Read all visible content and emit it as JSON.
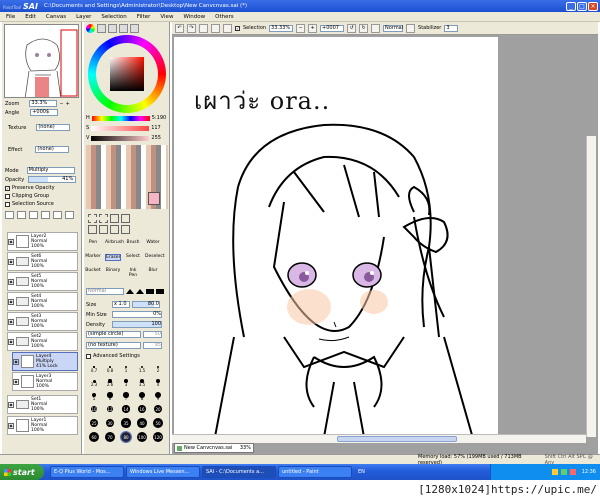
{
  "window": {
    "app_name": "SAI",
    "app_sub": "PaintTool",
    "title": "C:\\Documents and Settings\\Administrator\\Desktop\\New Canvcnvas.sai (*)"
  },
  "menu": [
    "File",
    "Edit",
    "Canvas",
    "Layer",
    "Selection",
    "Filter",
    "View",
    "Window",
    "Others"
  ],
  "navigator": {
    "zoom_label": "Zoom",
    "zoom_value": "33.3%",
    "angle_label": "Angle",
    "angle_value": "+000$"
  },
  "layer_props": {
    "texture_label": "Texture",
    "texture_value": "(none)",
    "effect_label": "Effect",
    "effect_value": "(none)",
    "mode_label": "Mode",
    "mode_value": "Multiply",
    "opacity_label": "Opacity",
    "opacity_value": "41%",
    "preserve_opacity": "Preserve Opacity",
    "clipping_group": "Clipping Group",
    "selection_source": "Selection Source"
  },
  "layers": [
    {
      "name": "Layer2",
      "mode": "Normal",
      "opacity": "100%",
      "type": "layer"
    },
    {
      "name": "Set6",
      "mode": "Normal",
      "opacity": "100%",
      "type": "folder"
    },
    {
      "name": "Set5",
      "mode": "Normal",
      "opacity": "100%",
      "type": "folder"
    },
    {
      "name": "Set4",
      "mode": "Normal",
      "opacity": "100%",
      "type": "folder"
    },
    {
      "name": "Set3",
      "mode": "Normal",
      "opacity": "100%",
      "type": "folder"
    },
    {
      "name": "Set2",
      "mode": "Normal",
      "opacity": "100%",
      "type": "folder"
    },
    {
      "name": "Layer4",
      "mode": "Multiply",
      "opacity": "41% Lock",
      "type": "layer",
      "selected": true
    },
    {
      "name": "Layer3",
      "mode": "Normal",
      "opacity": "100%",
      "type": "layer"
    },
    {
      "name": "Set1",
      "mode": "Normal",
      "opacity": "100%",
      "type": "folder"
    },
    {
      "name": "Layer1",
      "mode": "Normal",
      "opacity": "100%",
      "type": "layer"
    }
  ],
  "color": {
    "h_label": "H",
    "h_value": "5:190",
    "s_label": "S",
    "s_value": "117",
    "v_label": "V",
    "v_value": "255",
    "current": "#f6b5c4"
  },
  "tools": [
    [
      "Pen",
      "Airbrush",
      "Brush",
      "Water"
    ],
    [
      "Marker",
      "Eraser",
      "Select",
      "Deselect"
    ],
    [
      "Bucket",
      "Binary",
      "Ink Pen",
      "Blur"
    ]
  ],
  "brush": {
    "mode_value": "Normal",
    "size_label": "Size",
    "size_mult": "x 1.0",
    "size_value": "80.0",
    "minsize_label": "Min Size",
    "minsize_value": "0%",
    "density_label": "Density",
    "density_value": "100",
    "shape_value": "(simple circle)",
    "shape_num": "50",
    "texture_value": "(no texture)",
    "texture_num": "95",
    "advanced": "Advanced Settings"
  },
  "brush_sizes": [
    "0.7",
    "0.8",
    "1",
    "1.5",
    "2",
    "2.3",
    "2.6",
    "3",
    "3.5",
    "4",
    "5",
    "6",
    "7",
    "8",
    "9",
    "10",
    "12",
    "14",
    "16",
    "20",
    "25",
    "30",
    "35",
    "40",
    "50",
    "60",
    "70",
    "80",
    "100",
    "120"
  ],
  "canvas_toolbar": {
    "selection_label": "Selection",
    "zoom": "33.33%",
    "angle": "+0007",
    "blend": "Normal",
    "stabilizer_label": "Stabilizer",
    "stabilizer_value": "3"
  },
  "canvas": {
    "handwriting": "เผาว่ะ ora.."
  },
  "doc_tab": {
    "name": "New Canvcnvas.sai",
    "zoom": "33%"
  },
  "status": {
    "memory": "Memory load: 57% (199MB used / 713MB reserved)",
    "keys": "Shift Ctrl Alt SPC @ Any"
  },
  "taskbar": {
    "start": "start",
    "buttons": [
      "E-Q Plus World - Mos...",
      "Windows Live Messen...",
      "SAI - C:\\Documents a...",
      "untitled - Paint"
    ],
    "lang": "EN",
    "time": "12:36"
  },
  "watermark": "[1280x1024]https://upic.me/"
}
